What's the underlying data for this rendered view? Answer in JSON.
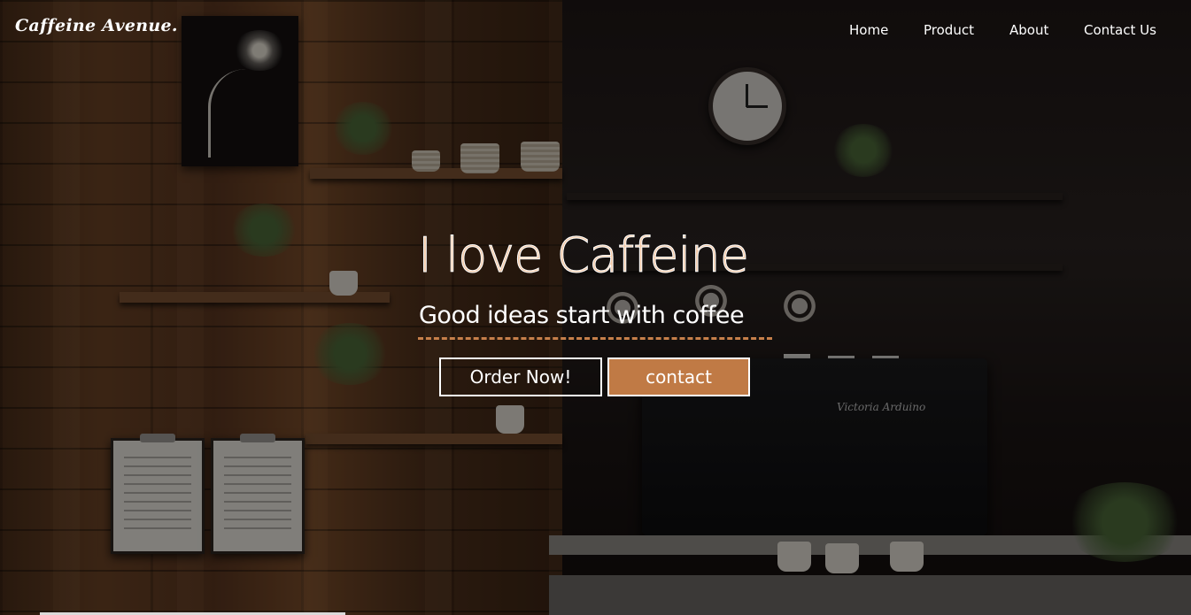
{
  "brand": {
    "logo": "Caffeine Avenue."
  },
  "nav": {
    "items": [
      {
        "label": "Home"
      },
      {
        "label": "Product"
      },
      {
        "label": "About"
      },
      {
        "label": "Contact Us"
      }
    ]
  },
  "hero": {
    "title": "I love Caffeine",
    "subtitle": "Good ideas start with coffee",
    "primary_button": "Order Now!",
    "secondary_button": "contact"
  },
  "background": {
    "machine_brand": "Victoria Arduino"
  },
  "colors": {
    "accent": "#c07a45",
    "title_fill": "#f2c7a4",
    "underline": "#c67f4a"
  }
}
